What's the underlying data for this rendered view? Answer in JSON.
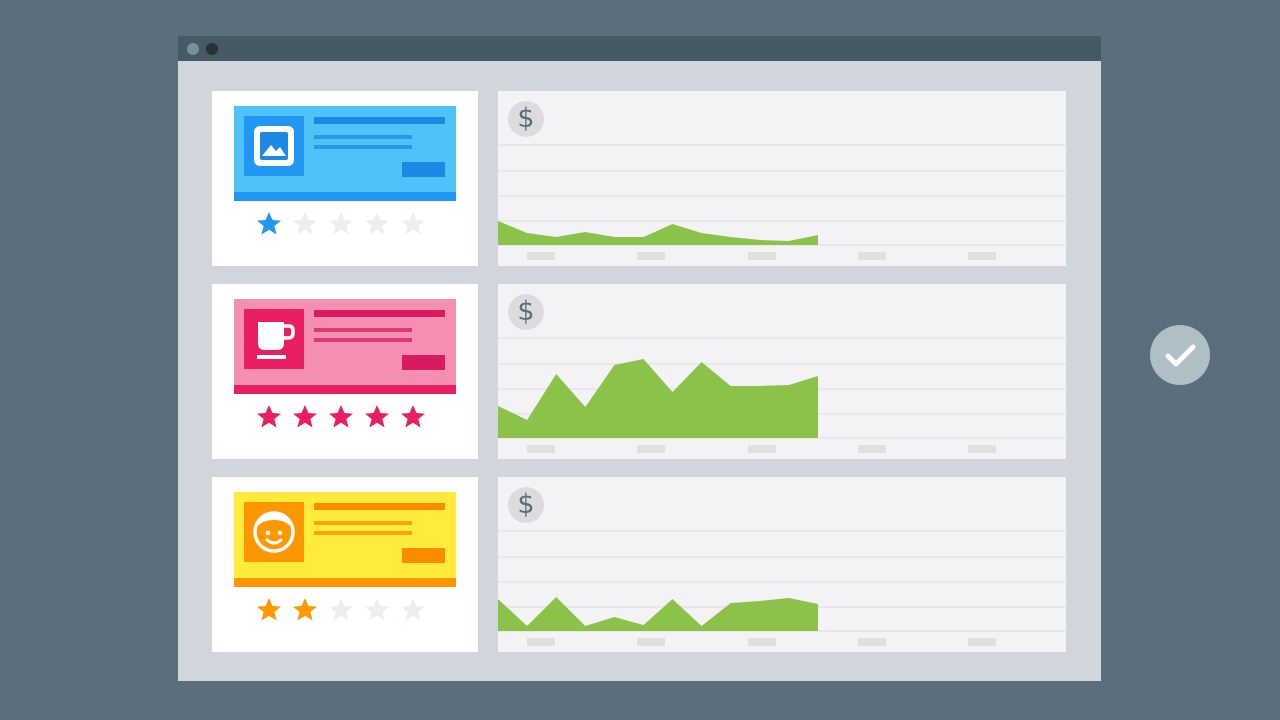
{
  "window": {
    "title": ""
  },
  "colors": {
    "background": "#5a6f7b",
    "window": "#d0d6db",
    "titlebar": "#455a64",
    "chart_fill": "#8bc34a",
    "star_empty": "#eceff1",
    "gridline": "#e4e4e8",
    "tick": "#e0e0e0"
  },
  "rows": [
    {
      "card_color": "#4fc3f7",
      "accent_color": "#2196f3",
      "line_color": "#1e88e5",
      "icon": "image-icon",
      "rating": 1,
      "rating_max": 5,
      "currency_symbol": "$",
      "chart_data": {
        "type": "area",
        "x": [
          0,
          1,
          2,
          3,
          4,
          5,
          6,
          7,
          8,
          9,
          10,
          11
        ],
        "values": [
          0.24,
          0.12,
          0.08,
          0.13,
          0.08,
          0.08,
          0.21,
          0.12,
          0.08,
          0.05,
          0.04,
          0.1
        ],
        "ylim": [
          0,
          1
        ],
        "grid": true
      }
    },
    {
      "card_color": "#f48fb1",
      "accent_color": "#e91e63",
      "line_color": "#d81b60",
      "icon": "cup-icon",
      "rating": 5,
      "rating_max": 5,
      "currency_symbol": "$",
      "chart_data": {
        "type": "area",
        "x": [
          0,
          1,
          2,
          3,
          4,
          5,
          6,
          7,
          8,
          9,
          10,
          11
        ],
        "values": [
          0.32,
          0.18,
          0.64,
          0.31,
          0.73,
          0.79,
          0.46,
          0.76,
          0.52,
          0.52,
          0.53,
          0.62
        ],
        "ylim": [
          0,
          1
        ],
        "grid": true
      }
    },
    {
      "card_color": "#ffeb3b",
      "accent_color": "#ff9800",
      "line_color": "#fb8c00",
      "icon": "face-icon",
      "rating": 2,
      "rating_max": 5,
      "currency_symbol": "$",
      "chart_data": {
        "type": "area",
        "x": [
          0,
          1,
          2,
          3,
          4,
          5,
          6,
          7,
          8,
          9,
          10,
          11
        ],
        "values": [
          0.32,
          0.05,
          0.34,
          0.05,
          0.14,
          0.06,
          0.32,
          0.05,
          0.28,
          0.3,
          0.33,
          0.27
        ],
        "ylim": [
          0,
          1
        ],
        "grid": true
      }
    }
  ],
  "status_icon": "checkmark-icon"
}
